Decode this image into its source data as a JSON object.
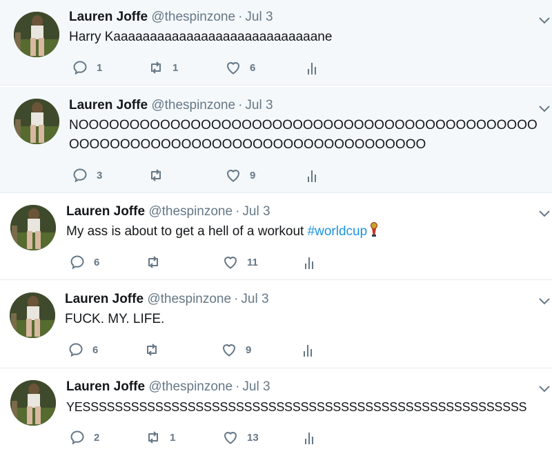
{
  "tweets": [
    {
      "name": "Lauren Joffe",
      "handle": "@thespinzone",
      "separator": "·",
      "date": "Jul 3",
      "text": "Harry Kaaaaaaaaaaaaaaaaaaaaaaaaaaaane",
      "replies": "1",
      "retweets": "1",
      "likes": "6"
    },
    {
      "name": "Lauren Joffe",
      "handle": "@thespinzone",
      "separator": "·",
      "date": "Jul 3",
      "text": "NOOOOOOOOOOOOOOOOOOOOOOOOOOOOOOOOOOOOOOOOOOOOOOOOOOOOOOOOOOOOOOOOOOOOOOOOOOOOOOOO",
      "replies": "3",
      "retweets": "",
      "likes": "9"
    },
    {
      "name": "Lauren Joffe",
      "handle": "@thespinzone",
      "separator": "·",
      "date": "Jul 3",
      "text": "My ass is about to get a hell of a workout ",
      "hashtag": "#worldcup",
      "replies": "6",
      "retweets": "",
      "likes": "11"
    },
    {
      "name": "Lauren Joffe",
      "handle": "@thespinzone",
      "separator": "·",
      "date": "Jul 3",
      "text": "FUCK. MY. LIFE.",
      "replies": "6",
      "retweets": "",
      "likes": "9"
    },
    {
      "name": "Lauren Joffe",
      "handle": "@thespinzone",
      "separator": "·",
      "date": "Jul 3",
      "text": "YESSSSSSSSSSSSSSSSSSSSSSSSSSSSSSSSSSSSSSSSSSSSSSSSSSSSSSS",
      "replies": "2",
      "retweets": "1",
      "likes": "13"
    }
  ],
  "icons": {
    "reply": "reply-icon",
    "retweet": "retweet-icon",
    "like": "heart-icon",
    "analytics": "analytics-icon",
    "caret": "chevron-down-icon",
    "emoji": "world-cup-trophy-emoji"
  },
  "colors": {
    "name": "#14171a",
    "secondary": "#657786",
    "hashtag": "#1b95e0",
    "highlight_bg": "#f5f8fa",
    "divider": "#e6ecf0"
  }
}
